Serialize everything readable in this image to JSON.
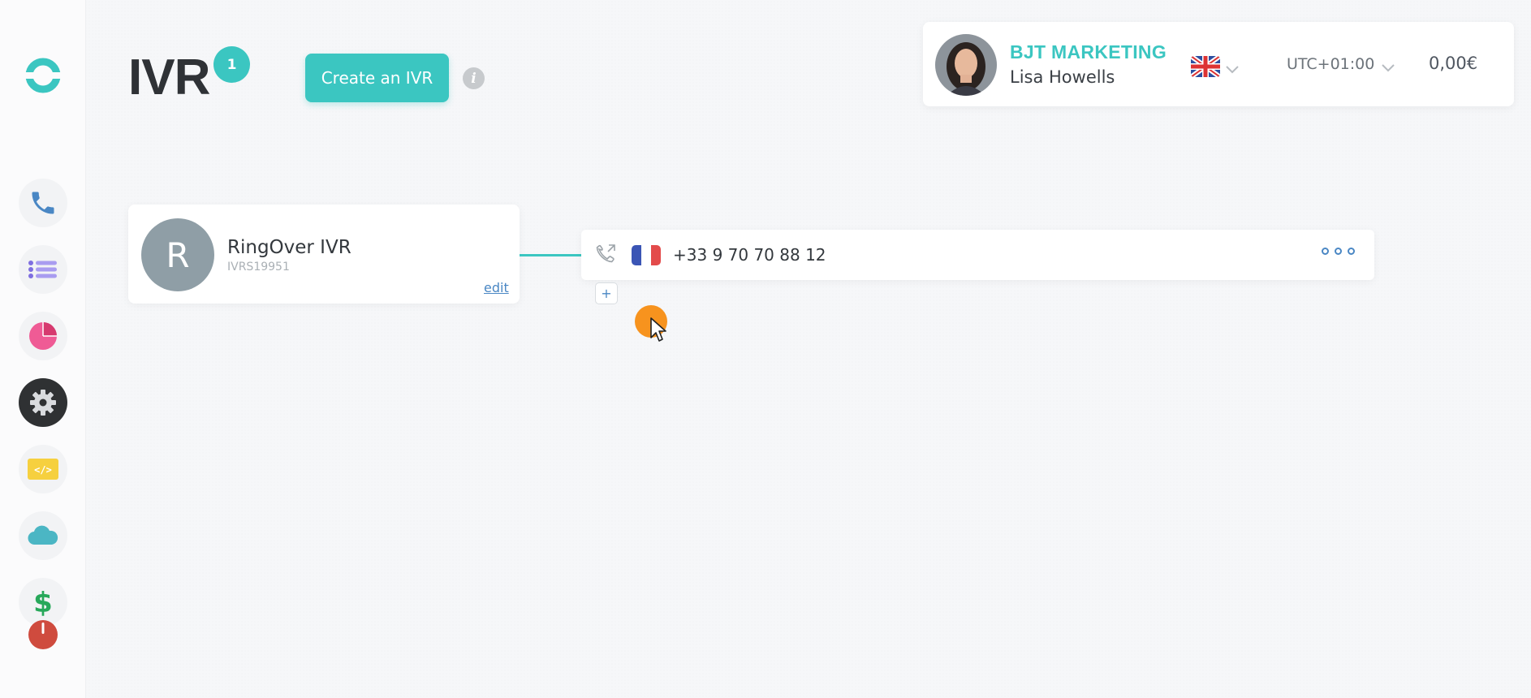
{
  "header": {
    "title": "IVR",
    "count": "1",
    "create_label": "Create an IVR",
    "info_glyph": "i"
  },
  "account": {
    "company": "BJT MARKETING",
    "user": "Lisa Howells",
    "timezone": "UTC+01:00",
    "balance": "0,00€"
  },
  "ivr": {
    "avatar_letter": "R",
    "name": "RingOver IVR",
    "id": "IVRS19951",
    "edit_label": "edit",
    "number": "+33 9 70 70 88 12",
    "add_label": "+"
  },
  "sidebar": {
    "items": [
      {
        "icon": "phone-icon"
      },
      {
        "icon": "list-icon"
      },
      {
        "icon": "pie-chart-icon"
      },
      {
        "icon": "gear-icon",
        "active": true
      },
      {
        "icon": "code-icon"
      },
      {
        "icon": "cloud-icon"
      },
      {
        "icon": "dollar-icon"
      },
      {
        "icon": "power-icon"
      }
    ]
  },
  "colors": {
    "accent": "#3bc6c1",
    "link": "#4a87c4",
    "cursor_highlight": "#f7931e"
  }
}
